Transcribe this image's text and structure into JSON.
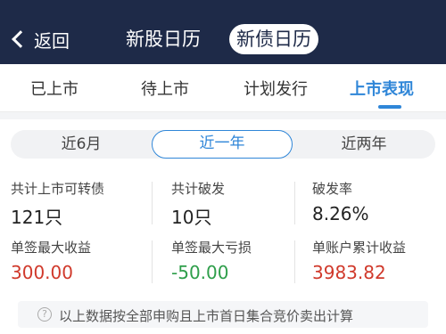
{
  "nav": {
    "back_label": "返回",
    "tabs": [
      "新股日历",
      "新债日历"
    ],
    "active_tab": "新债日历"
  },
  "subtabs": {
    "items": [
      "已上市",
      "待上市",
      "计划发行",
      "上市表现"
    ],
    "active": "上市表现"
  },
  "period": {
    "options": [
      "近6月",
      "近一年",
      "近两年"
    ],
    "selected": "近一年"
  },
  "stats": {
    "total_listed_label": "共计上市可转债",
    "total_listed_value": "121只",
    "total_broken_label": "共计破发",
    "total_broken_value": "10只",
    "broken_rate_label": "破发率",
    "broken_rate_value": "8.26%",
    "max_gain_label": "单签最大收益",
    "max_gain_value": "300.00",
    "max_loss_label": "单签最大亏损",
    "max_loss_value": "-50.00",
    "account_total_label": "单账户累计收益",
    "account_total_value": "3983.82"
  },
  "colors": {
    "header_bg": "#1e2a48",
    "accent_blue": "#2f86d8",
    "gain_red": "#d0392b",
    "loss_green": "#2e9e4a"
  },
  "note": {
    "icon": "question-circle-icon",
    "text": "以上数据按全部申购且上市首日集合竞价卖出计算"
  }
}
